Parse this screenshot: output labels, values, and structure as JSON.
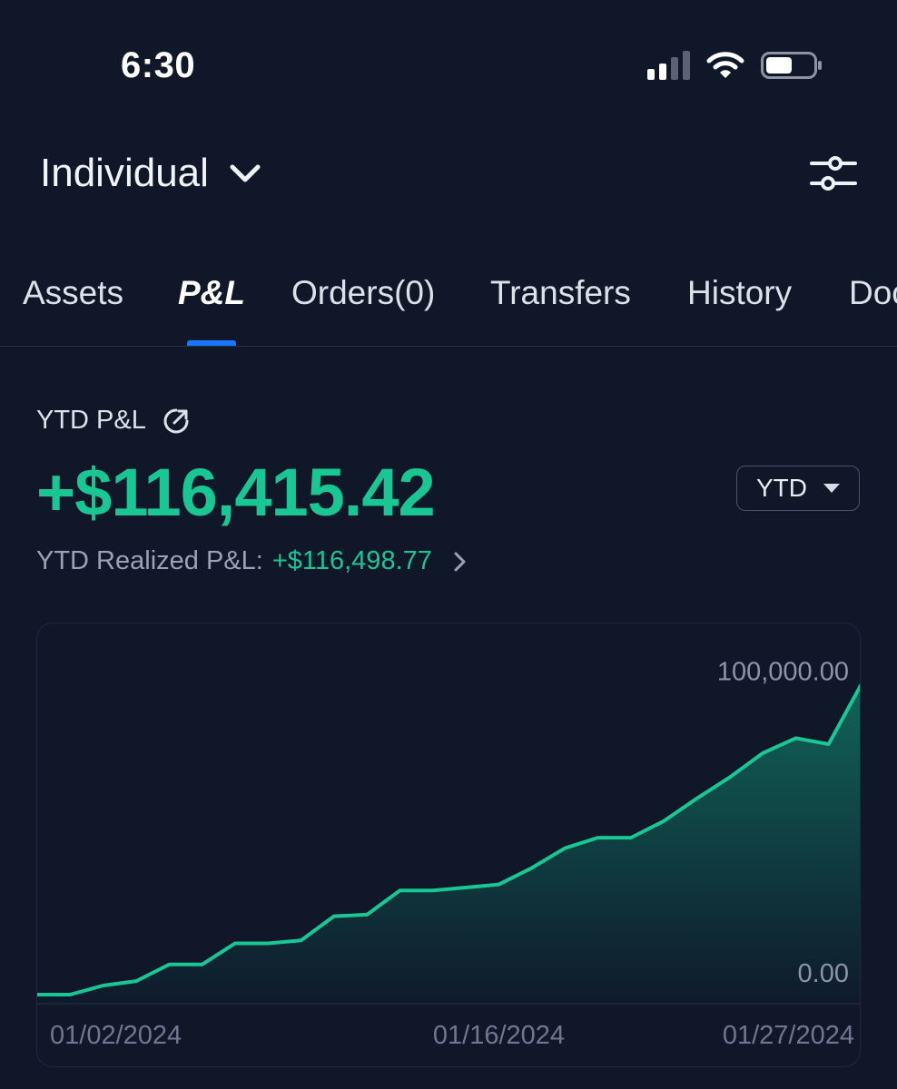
{
  "status_bar": {
    "time": "6:30",
    "icons": [
      "cellular-signal-icon",
      "wifi-icon",
      "battery-icon"
    ]
  },
  "header": {
    "account_name": "Individual",
    "account_dropdown_icon": "chevron-down-icon",
    "filter_icon": "sliders-icon"
  },
  "tabs": [
    {
      "label": "Assets",
      "active": false
    },
    {
      "label": "P&L",
      "active": true
    },
    {
      "label": "Orders(0)",
      "active": false
    },
    {
      "label": "Transfers",
      "active": false
    },
    {
      "label": "History",
      "active": false
    },
    {
      "label": "Doc",
      "active": false
    }
  ],
  "pnl": {
    "label": "YTD P&L",
    "value": "+$116,415.42",
    "period": "YTD",
    "realized_label": "YTD Realized P&L:",
    "realized_value": "+$116,498.77"
  },
  "colors": {
    "positive": "#18c794",
    "accent_tab": "#1677ff",
    "background": "#0f1729"
  },
  "chart_data": {
    "type": "area",
    "x": [
      "01/02/2024",
      "01/03/2024",
      "01/04/2024",
      "01/05/2024",
      "01/06/2024",
      "01/07/2024",
      "01/08/2024",
      "01/09/2024",
      "01/10/2024",
      "01/11/2024",
      "01/12/2024",
      "01/13/2024",
      "01/14/2024",
      "01/15/2024",
      "01/16/2024",
      "01/17/2024",
      "01/18/2024",
      "01/19/2024",
      "01/20/2024",
      "01/21/2024",
      "01/22/2024",
      "01/23/2024",
      "01/24/2024",
      "01/25/2024",
      "01/26/2024",
      "01/27/2024"
    ],
    "values": [
      0,
      0,
      3000,
      4500,
      10000,
      10000,
      17000,
      17000,
      18000,
      26000,
      26500,
      34500,
      34500,
      35500,
      36500,
      42000,
      48500,
      52000,
      52000,
      57500,
      65000,
      72000,
      80000,
      85000,
      83000,
      103000
    ],
    "x_tick_labels": [
      "01/02/2024",
      "01/16/2024",
      "01/27/2024"
    ],
    "y_tick_labels": [
      "100,000.00",
      "0.00"
    ],
    "ylim": [
      -3000,
      123000
    ],
    "grid": false,
    "line_color": "#18c794",
    "fill": "gradient"
  }
}
